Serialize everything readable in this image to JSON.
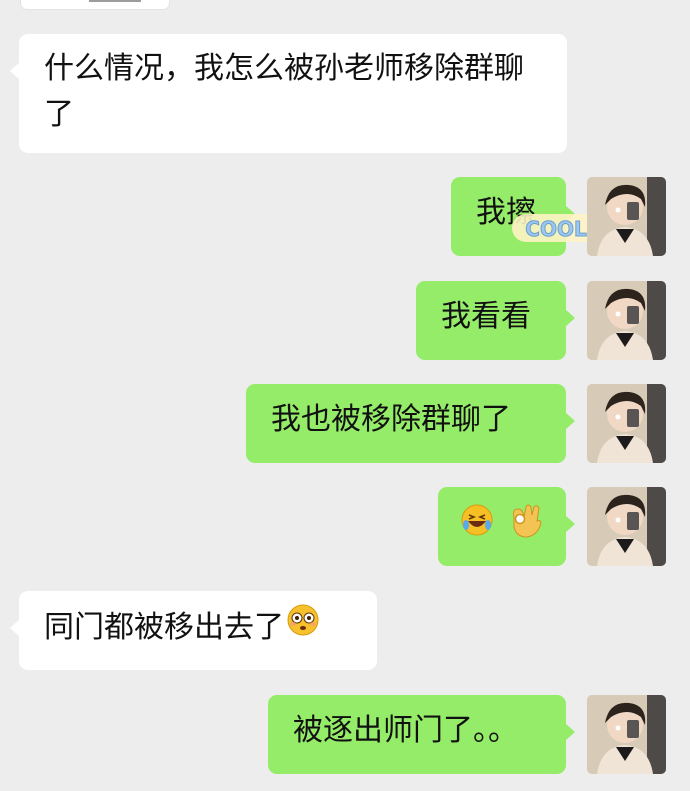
{
  "chat": {
    "messages": [
      {
        "side": "left",
        "text": "什么情况，我怎么被孙老师移除群聊了"
      },
      {
        "side": "right",
        "text": "我擦",
        "sticker_text": "COOL"
      },
      {
        "side": "right",
        "text": "我看看"
      },
      {
        "side": "right",
        "text": "我也被移除群聊了"
      },
      {
        "side": "right",
        "emojis": [
          "rofl-emoji",
          "ok-hand-emoji"
        ]
      },
      {
        "side": "left",
        "text": "同门都被移出去了",
        "emoji": "flushed-emoji"
      },
      {
        "side": "right",
        "text": "被逐出师门了。。"
      }
    ]
  },
  "colors": {
    "background": "#ededed",
    "left_bubble": "#ffffff",
    "right_bubble": "#95ec69",
    "text": "#111111"
  }
}
